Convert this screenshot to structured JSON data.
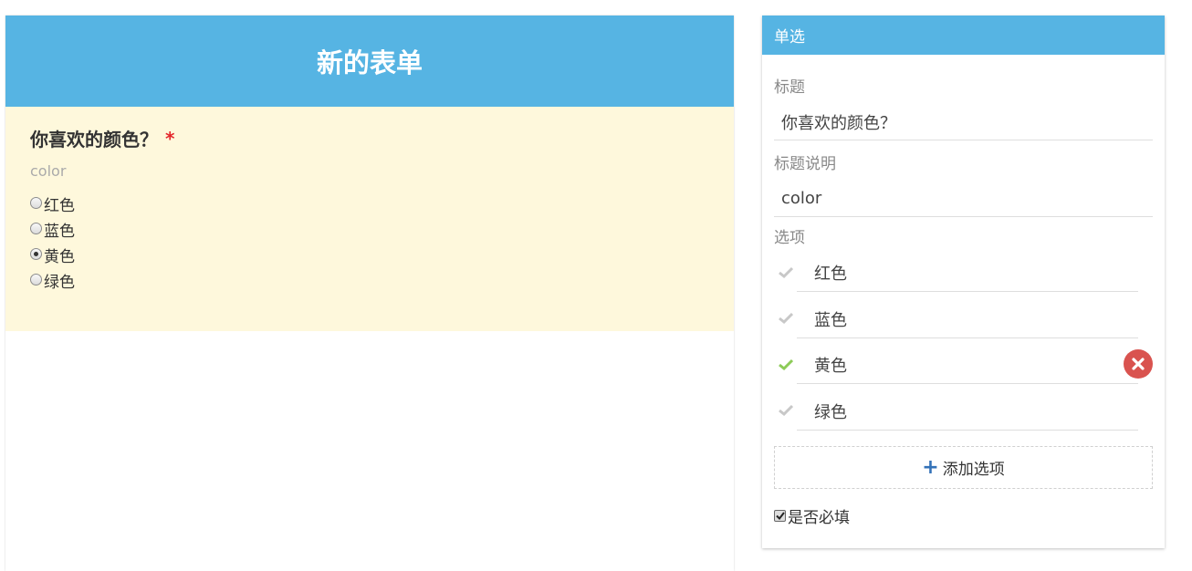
{
  "form": {
    "title": "新的表单",
    "question": {
      "title": "你喜欢的颜色？",
      "required_mark": "*",
      "description": "color",
      "options": [
        {
          "label": "红色",
          "selected": false
        },
        {
          "label": "蓝色",
          "selected": false
        },
        {
          "label": "黄色",
          "selected": true
        },
        {
          "label": "绿色",
          "selected": false
        }
      ]
    }
  },
  "panel": {
    "header": "单选",
    "title_label": "标题",
    "title_value": "你喜欢的颜色？",
    "desc_label": "标题说明",
    "desc_value": "color",
    "options_label": "选项",
    "options": [
      {
        "label": "红色",
        "active": false
      },
      {
        "label": "蓝色",
        "active": false
      },
      {
        "label": "黄色",
        "active": true
      },
      {
        "label": "绿色",
        "active": false
      }
    ],
    "add_option_label": "添加选项",
    "required_label": "是否必填",
    "required_checked": true
  },
  "colors": {
    "header_blue": "#56b4e3",
    "question_bg": "#fef8dc",
    "required_red": "#e4262b",
    "check_active": "#8dcb58",
    "check_inactive": "#c8c8c8",
    "delete_red": "#d9534f",
    "plus_blue": "#3372b8"
  }
}
